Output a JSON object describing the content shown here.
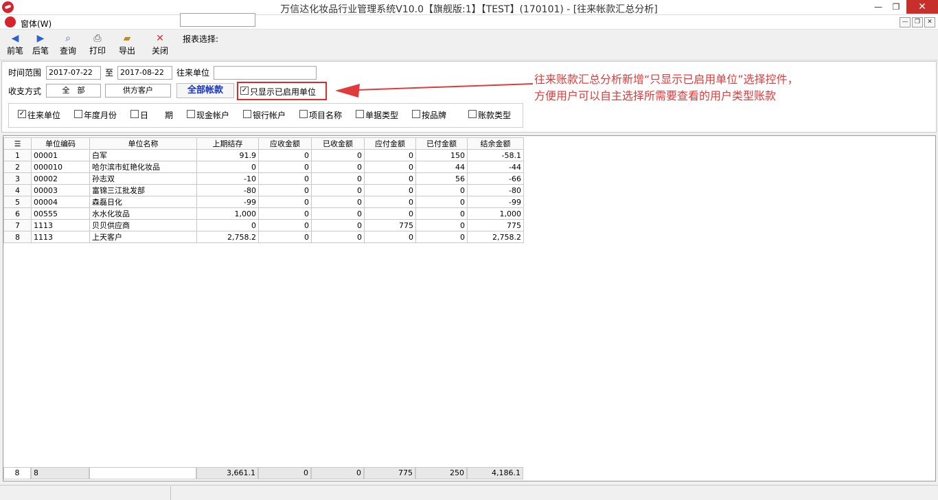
{
  "window": {
    "title": "万信达化妆品行业管理系统V10.0【旗舰版:1】【TEST】(170101) - [往来帐款汇总分析]",
    "min": "—",
    "max": "❐",
    "close": "✕"
  },
  "menu": {
    "window_label": "窗体(W)"
  },
  "toolbar": {
    "prev": "前笔",
    "next": "后笔",
    "query": "查询",
    "print": "打印",
    "export": "导出",
    "close": "关闭",
    "report_label": "报表选择:"
  },
  "filters": {
    "time_range_label": "时间范围",
    "date_from": "2017-07-22",
    "to_label": "至",
    "date_to": "2017-08-22",
    "partner_label": "往来单位",
    "partner_value": "",
    "payment_label": "收支方式",
    "payment_value": "全　部",
    "customer_type": "供方客户",
    "all_accounts": "全部帐款",
    "only_enabled_label": "只显示已启用单位",
    "group_options": [
      {
        "label": "往来单位",
        "checked": true
      },
      {
        "label": "年度月份",
        "checked": false
      },
      {
        "label": "日　　期",
        "checked": false
      },
      {
        "label": "现金帐户",
        "checked": false
      },
      {
        "label": "银行帐户",
        "checked": false
      },
      {
        "label": "项目名称",
        "checked": false
      },
      {
        "label": "单据类型",
        "checked": false
      },
      {
        "label": "按品牌",
        "checked": false
      },
      {
        "label": "账款类型",
        "checked": false
      }
    ]
  },
  "annotation": {
    "line1": "往来账款汇总分析新增“只显示已启用单位”选择控件，",
    "line2": "方便用户可以自主选择所需要查看的用户类型账款"
  },
  "grid": {
    "columns": [
      "单位编码",
      "单位名称",
      "上期结存",
      "应收金额",
      "已收金额",
      "应付金额",
      "已付金额",
      "结余金额"
    ],
    "rows": [
      {
        "idx": "1",
        "code": "00001",
        "name": "白军",
        "prev": "91.9",
        "recv": "0",
        "received": "0",
        "pay": "0",
        "paid": "150",
        "balance": "-58.1"
      },
      {
        "idx": "2",
        "code": "000010",
        "name": "哈尔滨市虹艳化妆品",
        "prev": "0",
        "recv": "0",
        "received": "0",
        "pay": "0",
        "paid": "44",
        "balance": "-44"
      },
      {
        "idx": "3",
        "code": "00002",
        "name": "孙志双",
        "prev": "-10",
        "recv": "0",
        "received": "0",
        "pay": "0",
        "paid": "56",
        "balance": "-66"
      },
      {
        "idx": "4",
        "code": "00003",
        "name": "富锦三江批发部",
        "prev": "-80",
        "recv": "0",
        "received": "0",
        "pay": "0",
        "paid": "0",
        "balance": "-80"
      },
      {
        "idx": "5",
        "code": "00004",
        "name": "森磊日化",
        "prev": "-99",
        "recv": "0",
        "received": "0",
        "pay": "0",
        "paid": "0",
        "balance": "-99"
      },
      {
        "idx": "6",
        "code": "00555",
        "name": "水水化妆品",
        "prev": "1,000",
        "recv": "0",
        "received": "0",
        "pay": "0",
        "paid": "0",
        "balance": "1,000"
      },
      {
        "idx": "7",
        "code": "1113",
        "name": "贝贝供应商",
        "prev": "0",
        "recv": "0",
        "received": "0",
        "pay": "775",
        "paid": "0",
        "balance": "775"
      },
      {
        "idx": "8",
        "code": "1113",
        "name": "上天客户",
        "prev": "2,758.2",
        "recv": "0",
        "received": "0",
        "pay": "0",
        "paid": "0",
        "balance": "2,758.2"
      }
    ],
    "footer": {
      "idx": "8",
      "count": "8",
      "name": "",
      "prev": "3,661.1",
      "recv": "0",
      "received": "0",
      "pay": "775",
      "paid": "250",
      "balance": "4,186.1"
    }
  }
}
